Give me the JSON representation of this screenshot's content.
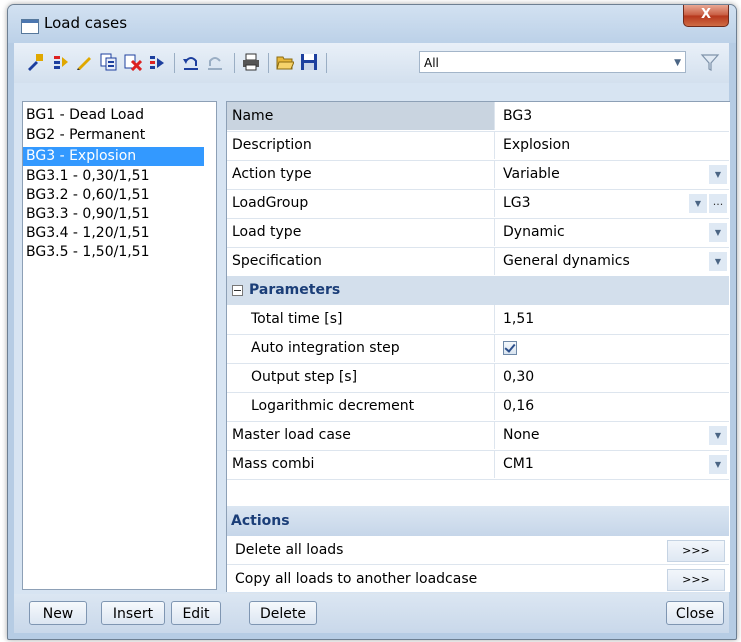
{
  "window": {
    "title": "Load cases",
    "close_label": "X"
  },
  "toolbar": {
    "icons": [
      "new-icon",
      "insert-icon",
      "edit-icon",
      "copy-icon",
      "delete-icon",
      "move-icon",
      "undo-icon",
      "redo-icon",
      "print-icon",
      "open-icon",
      "save-icon"
    ],
    "filter_value": "All"
  },
  "load_cases": [
    "BG1 - Dead Load",
    "BG2 - Permanent",
    "BG3 - Explosion",
    "BG3.1 - 0,30/1,51",
    "BG3.2 - 0,60/1,51",
    "BG3.3 - 0,90/1,51",
    "BG3.4 - 1,20/1,51",
    "BG3.5 - 1,50/1,51"
  ],
  "selected_load_case": "BG3 - Explosion",
  "properties": {
    "name": {
      "label": "Name",
      "value": "BG3"
    },
    "description": {
      "label": "Description",
      "value": "Explosion"
    },
    "action_type": {
      "label": "Action type",
      "value": "Variable"
    },
    "load_group": {
      "label": "LoadGroup",
      "value": "LG3",
      "more": "..."
    },
    "load_type": {
      "label": "Load type",
      "value": "Dynamic"
    },
    "specification": {
      "label": "Specification",
      "value": "General dynamics"
    },
    "parameters": {
      "label": "Parameters",
      "total_time": {
        "label": "Total time [s]",
        "value": "1,51"
      },
      "auto_integration_step": {
        "label": "Auto integration step",
        "checked": true
      },
      "output_step": {
        "label": "Output step [s]",
        "value": "0,30"
      },
      "log_decrement": {
        "label": "Logarithmic decrement",
        "value": "0,16"
      }
    },
    "master_load_case": {
      "label": "Master load case",
      "value": "None"
    },
    "mass_combi": {
      "label": "Mass combi",
      "value": "CM1"
    }
  },
  "actions": {
    "header": "Actions",
    "items": [
      {
        "label": "Delete all loads",
        "button": ">>>"
      },
      {
        "label": "Copy all loads to another loadcase",
        "button": ">>>"
      }
    ]
  },
  "buttons": {
    "new": "New",
    "insert": "Insert",
    "edit": "Edit",
    "delete": "Delete",
    "close": "Close"
  }
}
